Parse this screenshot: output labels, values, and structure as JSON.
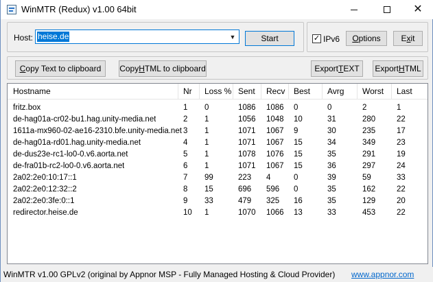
{
  "window": {
    "title": "WinMTR (Redux) v1.00 64bit"
  },
  "host": {
    "label": "Host:",
    "value": "heise.de"
  },
  "buttons": {
    "start": "Start",
    "ipv6_label": "IPv6",
    "ipv6_checked": true,
    "options_prefix": "",
    "options_u": "O",
    "options_rest": "ptions",
    "exit_prefix": "E",
    "exit_u": "x",
    "exit_rest": "it",
    "copy_text_u": "C",
    "copy_text_rest": "opy Text to clipboard",
    "copy_html_prefix": "Copy ",
    "copy_html_u": "H",
    "copy_html_rest": "TML to clipboard",
    "export_text_prefix": "Export ",
    "export_text_u": "T",
    "export_text_rest": "EXT",
    "export_html_prefix": "Export ",
    "export_html_u": "H",
    "export_html_rest": "TML"
  },
  "table": {
    "columns": [
      "Hostname",
      "Nr",
      "Loss %",
      "Sent",
      "Recv",
      "Best",
      "Avrg",
      "Worst",
      "Last"
    ],
    "rows": [
      [
        "fritz.box",
        "1",
        "0",
        "1086",
        "1086",
        "0",
        "0",
        "2",
        "1"
      ],
      [
        "de-hag01a-cr02-bu1.hag.unity-media.net",
        "2",
        "1",
        "1056",
        "1048",
        "10",
        "31",
        "280",
        "22"
      ],
      [
        "1611a-mx960-02-ae16-2310.bfe.unity-media.net",
        "3",
        "1",
        "1071",
        "1067",
        "9",
        "30",
        "235",
        "17"
      ],
      [
        "de-hag01a-rd01.hag.unity-media.net",
        "4",
        "1",
        "1071",
        "1067",
        "15",
        "34",
        "349",
        "23"
      ],
      [
        "de-dus23e-rc1-lo0-0.v6.aorta.net",
        "5",
        "1",
        "1078",
        "1076",
        "15",
        "35",
        "291",
        "19"
      ],
      [
        "de-fra01b-rc2-lo0-0.v6.aorta.net",
        "6",
        "1",
        "1071",
        "1067",
        "15",
        "36",
        "297",
        "24"
      ],
      [
        "2a02:2e0:10:17::1",
        "7",
        "99",
        "223",
        "4",
        "0",
        "39",
        "59",
        "33"
      ],
      [
        "2a02:2e0:12:32::2",
        "8",
        "15",
        "696",
        "596",
        "0",
        "35",
        "162",
        "22"
      ],
      [
        "2a02:2e0:3fe:0::1",
        "9",
        "33",
        "479",
        "325",
        "16",
        "35",
        "129",
        "20"
      ],
      [
        "redirector.heise.de",
        "10",
        "1",
        "1070",
        "1066",
        "13",
        "33",
        "453",
        "22"
      ]
    ]
  },
  "statusbar": {
    "text": "WinMTR v1.00 GPLv2 (original by Appnor MSP - Fully Managed Hosting & Cloud Provider)",
    "link": "www.appnor.com"
  }
}
